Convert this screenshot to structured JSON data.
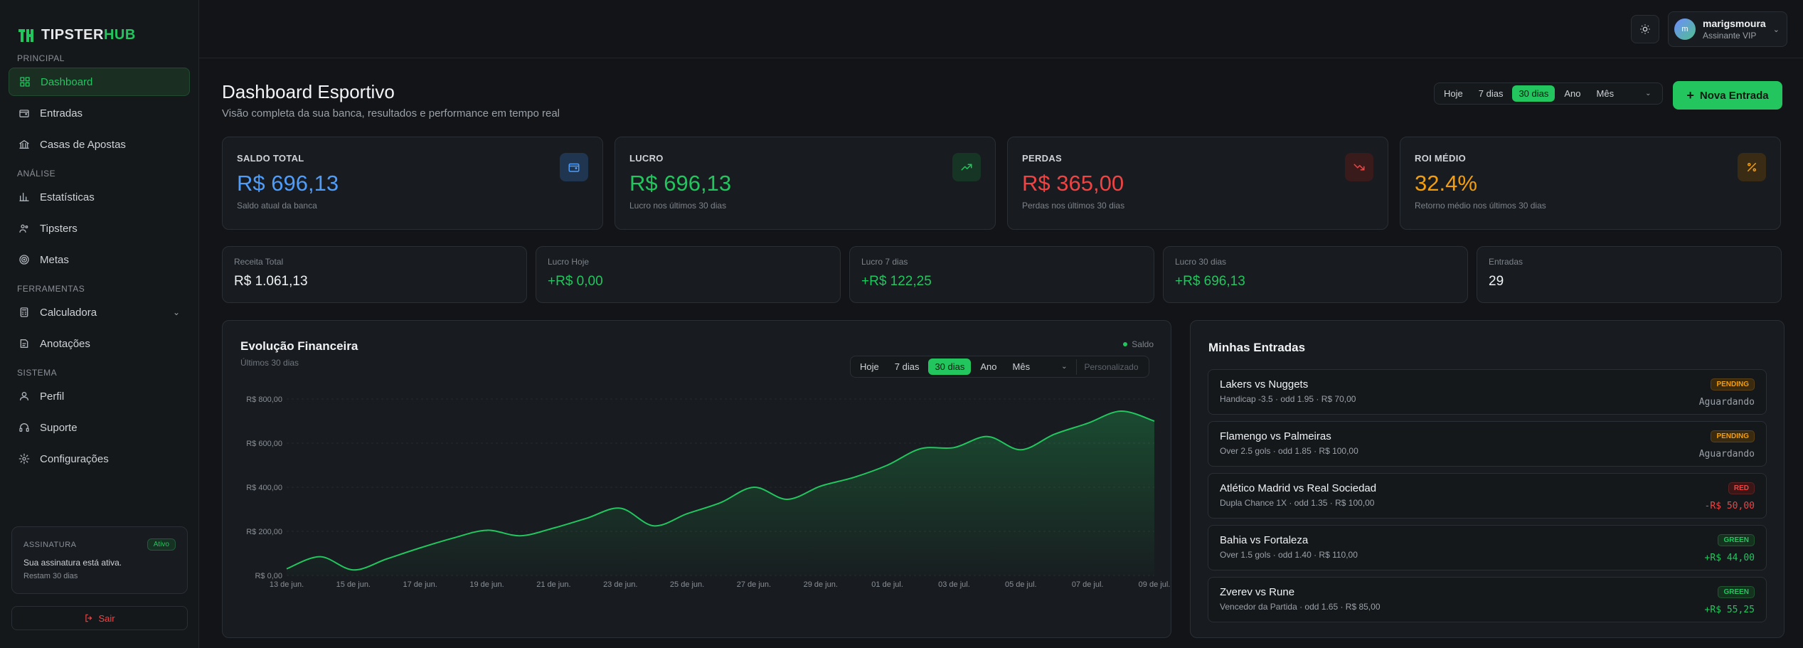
{
  "brand": {
    "part1": "TIPSTER",
    "part2": "HUB",
    "accent": "#22c55e"
  },
  "sidebar": {
    "sections": [
      {
        "title": "PRINCIPAL",
        "items": [
          {
            "label": "Dashboard",
            "icon": "grid-icon",
            "active": true
          },
          {
            "label": "Entradas",
            "icon": "wallet-icon"
          },
          {
            "label": "Casas de Apostas",
            "icon": "bank-icon"
          }
        ]
      },
      {
        "title": "ANÁLISE",
        "items": [
          {
            "label": "Estatísticas",
            "icon": "bar-chart-icon"
          },
          {
            "label": "Tipsters",
            "icon": "users-icon"
          },
          {
            "label": "Metas",
            "icon": "target-icon"
          }
        ]
      },
      {
        "title": "FERRAMENTAS",
        "items": [
          {
            "label": "Calculadora",
            "icon": "calculator-icon",
            "expandable": true
          },
          {
            "label": "Anotações",
            "icon": "notes-icon"
          }
        ]
      },
      {
        "title": "SISTEMA",
        "items": [
          {
            "label": "Perfil",
            "icon": "user-icon"
          },
          {
            "label": "Suporte",
            "icon": "headset-icon"
          },
          {
            "label": "Configurações",
            "icon": "gear-icon"
          }
        ]
      }
    ],
    "subscription": {
      "title": "ASSINATURA",
      "badge": "Ativo",
      "text": "Sua assinatura está ativa.",
      "remaining": "Restam 30 dias"
    },
    "logout": "Sair"
  },
  "topbar": {
    "user_name": "marigsmoura",
    "user_role": "Assinante VIP",
    "avatar_letter": "m"
  },
  "header": {
    "title": "Dashboard Esportivo",
    "subtitle": "Visão completa da sua banca, resultados e performance em tempo real"
  },
  "range": {
    "options": [
      "Hoje",
      "7 dias",
      "30 dias",
      "Ano"
    ],
    "active": "30 dias",
    "select": "Mês"
  },
  "new_entry": "Nova Entrada",
  "kpis": [
    {
      "label": "SALDO TOTAL",
      "value": "R$ 696,13",
      "sub": "Saldo atual da banca",
      "color": "#4f9cf9",
      "icon": "wallet-icon"
    },
    {
      "label": "LUCRO",
      "value": "R$ 696,13",
      "sub": "Lucro nos últimos 30 dias",
      "color": "#22c55e",
      "icon": "trend-up-icon"
    },
    {
      "label": "PERDAS",
      "value": "R$ 365,00",
      "sub": "Perdas nos últimos 30 dias",
      "color": "#ef4444",
      "icon": "trend-down-icon"
    },
    {
      "label": "ROI MÉDIO",
      "value": "32.4%",
      "sub": "Retorno médio nos últimos 30 dias",
      "color": "#f59e0b",
      "icon": "percent-icon"
    }
  ],
  "minis": [
    {
      "label": "Receita Total",
      "value": "R$ 1.061,13",
      "color": "#f0f2f4"
    },
    {
      "label": "Lucro Hoje",
      "value": "+R$ 0,00",
      "color": "#22c55e"
    },
    {
      "label": "Lucro 7 dias",
      "value": "+R$ 122,25",
      "color": "#22c55e"
    },
    {
      "label": "Lucro 30 dias",
      "value": "+R$ 696,13",
      "color": "#22c55e"
    },
    {
      "label": "Entradas",
      "value": "29",
      "color": "#f0f2f4"
    }
  ],
  "chart": {
    "title": "Evolução Financeira",
    "subtitle": "Últimos 30 dias",
    "legend": "Saldo",
    "custom": "Personalizado"
  },
  "chart_data": {
    "type": "area",
    "x": [
      "13 de jun.",
      "14 de jun.",
      "15 de jun.",
      "16 de jun.",
      "17 de jun.",
      "18 de jun.",
      "19 de jun.",
      "20 de jun.",
      "21 de jun.",
      "22 de jun.",
      "23 de jun.",
      "24 de jun.",
      "25 de jun.",
      "26 de jun.",
      "27 de jun.",
      "28 de jun.",
      "29 de jun.",
      "30 de jun.",
      "01 de jul.",
      "02 de jul.",
      "03 de jul.",
      "04 de jul.",
      "05 de jul.",
      "06 de jul.",
      "07 de jul.",
      "08 de jul.",
      "09 de jul."
    ],
    "x_tick_labels": [
      "13 de jun.",
      "15 de jun.",
      "17 de jun.",
      "19 de jun.",
      "21 de jun.",
      "23 de jun.",
      "25 de jun.",
      "27 de jun.",
      "29 de jun.",
      "01 de jul.",
      "03 de jul.",
      "05 de jul.",
      "07 de jul.",
      "09 de jul."
    ],
    "series": [
      {
        "name": "Saldo",
        "values": [
          30,
          85,
          25,
          75,
          125,
          170,
          205,
          180,
          215,
          260,
          305,
          225,
          280,
          330,
          400,
          345,
          405,
          445,
          500,
          575,
          580,
          630,
          570,
          640,
          690,
          745,
          700
        ]
      }
    ],
    "y_ticks": [
      "R$ 0,00",
      "R$ 200,00",
      "R$ 400,00",
      "R$ 600,00",
      "R$ 800,00"
    ],
    "ylim": [
      0,
      800
    ],
    "grid": true,
    "color": "#22c55e"
  },
  "entries": {
    "title": "Minhas Entradas",
    "items": [
      {
        "name": "Lakers vs Nuggets",
        "detail": "Handicap -3.5 · odd 1.95 · R$ 70,00",
        "badge": "PENDING",
        "result": "Aguardando",
        "kind": "pend"
      },
      {
        "name": "Flamengo vs Palmeiras",
        "detail": "Over 2.5 gols · odd 1.85 · R$ 100,00",
        "badge": "PENDING",
        "result": "Aguardando",
        "kind": "pend"
      },
      {
        "name": "Atlético Madrid vs Real Sociedad",
        "detail": "Dupla Chance 1X · odd 1.35 · R$ 100,00",
        "badge": "RED",
        "result": "-R$ 50,00",
        "kind": "red"
      },
      {
        "name": "Bahia vs Fortaleza",
        "detail": "Over 1.5 gols · odd 1.40 · R$ 110,00",
        "badge": "GREEN",
        "result": "+R$ 44,00",
        "kind": "green"
      },
      {
        "name": "Zverev vs Rune",
        "detail": "Vencedor da Partida · odd 1.65 · R$ 85,00",
        "badge": "GREEN",
        "result": "+R$ 55,25",
        "kind": "green"
      }
    ]
  }
}
